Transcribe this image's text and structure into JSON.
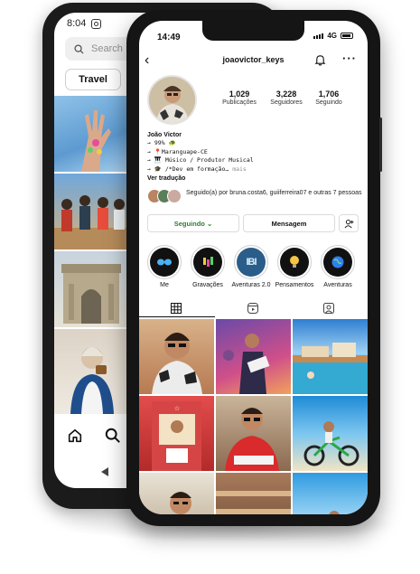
{
  "back_phone": {
    "status_time": "8:04",
    "search_placeholder": "Search",
    "chip_label": "Travel"
  },
  "front_phone": {
    "status_time": "14:49",
    "network": "4G",
    "username": "joaovictor_keys",
    "stats": [
      {
        "value": "1,029",
        "label": "Publicações"
      },
      {
        "value": "3,228",
        "label": "Seguidores"
      },
      {
        "value": "1,706",
        "label": "Seguindo"
      }
    ],
    "bio": {
      "name": "João Victor",
      "line1": "→ 99% 🐢",
      "line2": "→ 📍Maranguape-CE",
      "line3": "→ 🎹 Músico / Produtor Musical",
      "line4": "→ 🎓 /*Dev em formação…",
      "more": " mais",
      "translate": "Ver tradução"
    },
    "followed_by": "Seguido(a) por bruna.costa6, guiiferreira07 e outras 7 pessoas",
    "buttons": {
      "following": "Seguindo ⌄",
      "message": "Mensagem"
    },
    "highlights": [
      {
        "label": "Me",
        "icon": "glasses-icon"
      },
      {
        "label": "Gravações",
        "icon": "music-icon"
      },
      {
        "label": "Aventuras 2.0",
        "icon": "letters-icon"
      },
      {
        "label": "Pensamentos",
        "icon": "bulb-icon"
      },
      {
        "label": "Aventuras",
        "icon": "globe-icon"
      }
    ],
    "tabs": [
      "grid-icon",
      "reels-icon",
      "tagged-icon"
    ],
    "accent": "#3897f0"
  }
}
